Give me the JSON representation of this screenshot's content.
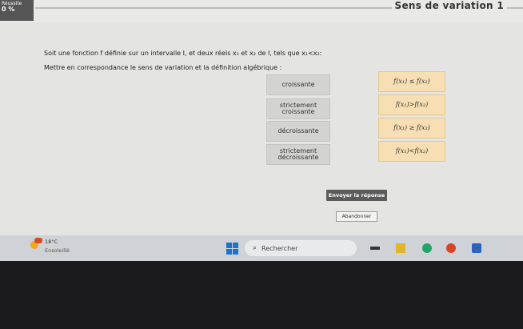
{
  "progress": {
    "top_label": "Réussite",
    "value": "0 %"
  },
  "page": {
    "title": "Sens de variation 1"
  },
  "question": {
    "intro": "Soit une fonction f définie sur un intervalle I, et deux réels x₁ et x₂ de I, tels que x₁<x₂:",
    "instruction": "Mettre en correspondance le sens de variation et la définition algébrique :"
  },
  "left_items": [
    {
      "line1": "croissante",
      "line2": ""
    },
    {
      "line1": "strictement",
      "line2": "croissante"
    },
    {
      "line1": "décroissante",
      "line2": ""
    },
    {
      "line1": "strictement",
      "line2": "décroissante"
    }
  ],
  "right_items": [
    "f(x₁) ≤ f(x₂)",
    "f(x₁)>f(x₂)",
    "f(x₁) ≥ f(x₂)",
    "f(x₁)<f(x₂)"
  ],
  "buttons": {
    "send": "Envoyer la réponse",
    "abandon": "Abandonner"
  },
  "taskbar": {
    "temperature": "18°C",
    "condition": "Ensoleillé",
    "search_placeholder": "Rechercher"
  }
}
